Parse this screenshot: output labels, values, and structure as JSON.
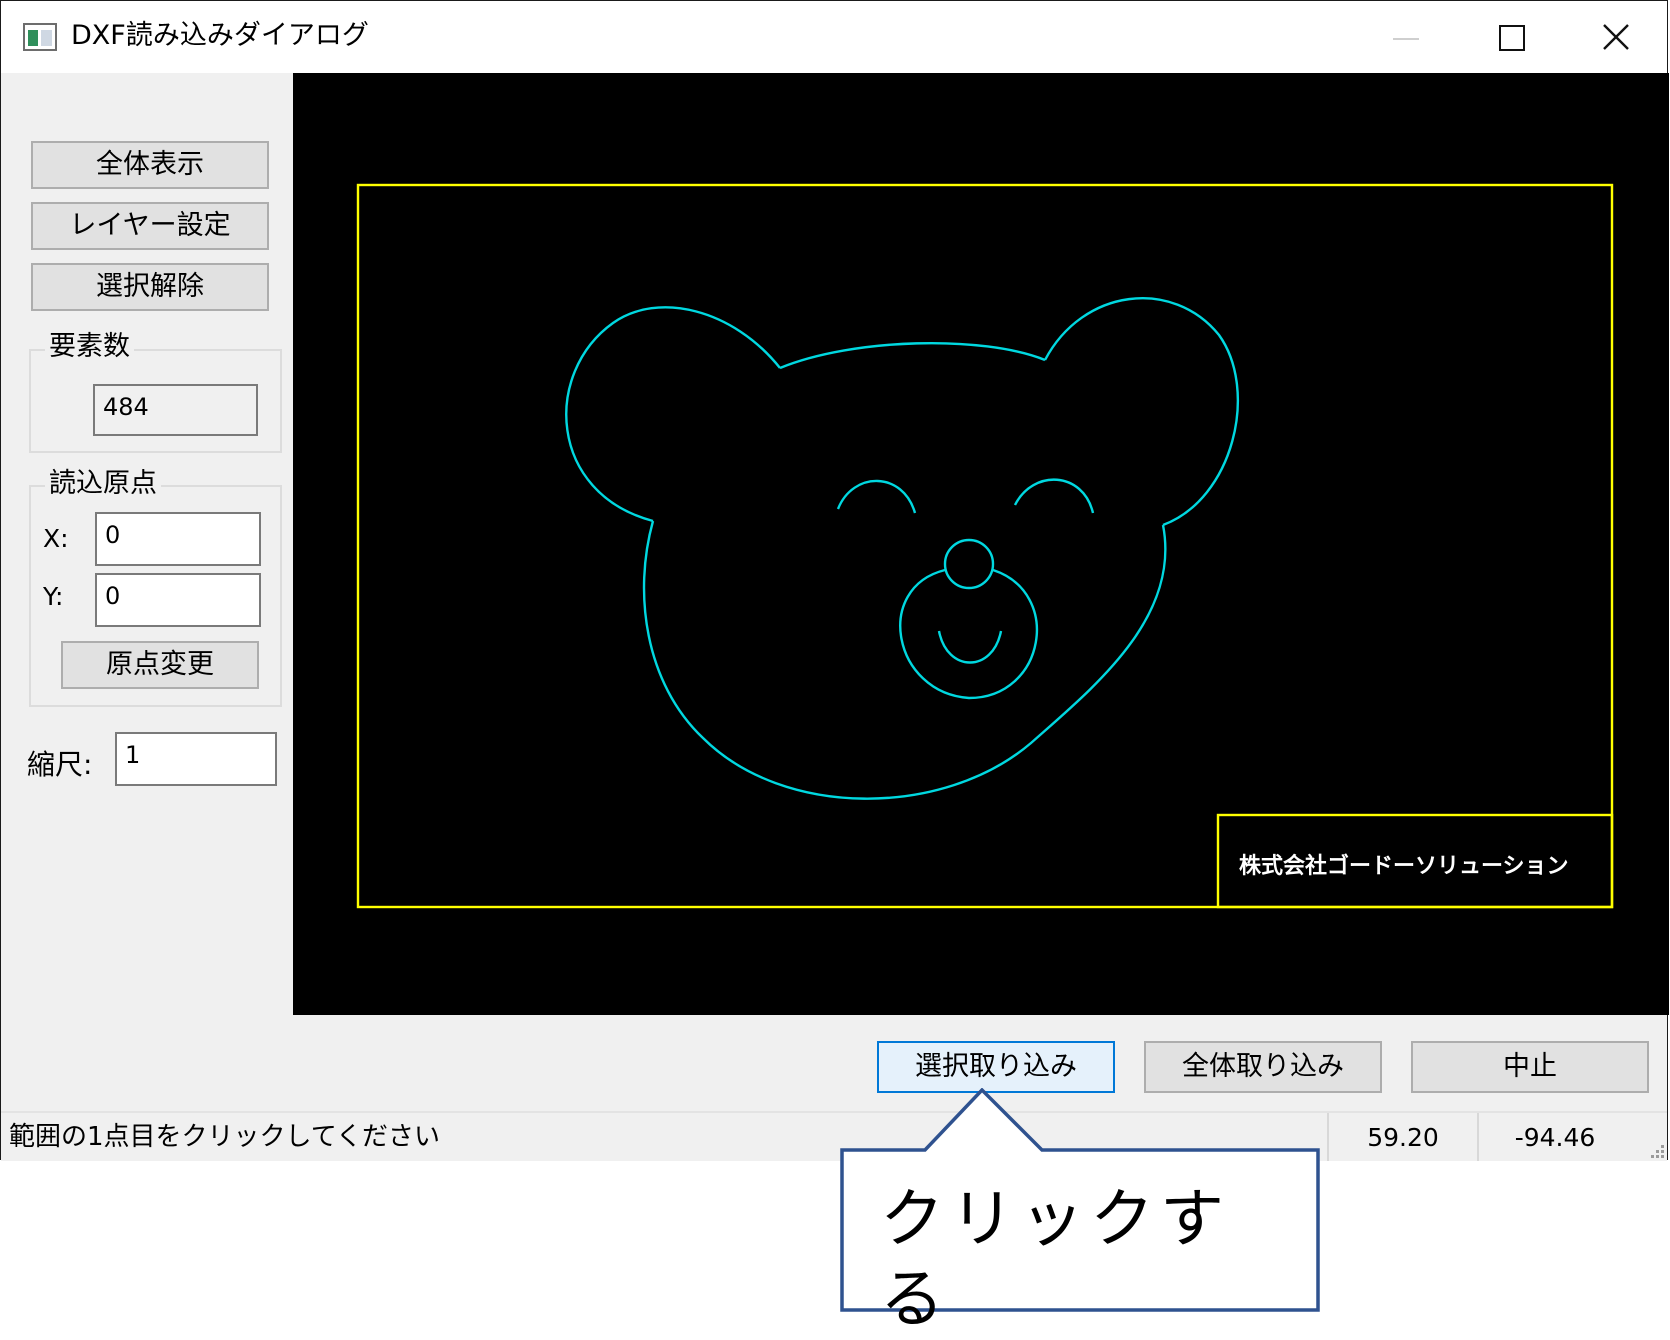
{
  "window": {
    "title": "DXF読み込みダイアログ"
  },
  "sidebar": {
    "buttons": [
      "全体表示",
      "レイヤー設定",
      "選択解除"
    ],
    "element_count": {
      "legend": "要素数",
      "value": "484"
    },
    "origin": {
      "legend": "読込原点",
      "x_label": "X:",
      "x_value": "0",
      "y_label": "Y:",
      "y_value": "0",
      "change_button": "原点変更"
    },
    "scale": {
      "label": "縮尺:",
      "value": "1"
    }
  },
  "canvas": {
    "background": "#000000",
    "frame_color": "#ffff00",
    "drawing_color": "#00d8e0",
    "title_block_text": "株式会社ゴードーソリューション"
  },
  "actions": {
    "import_selection": "選択取り込み",
    "import_all": "全体取り込み",
    "cancel": "中止"
  },
  "status": {
    "message": "範囲の1点目をクリックしてください",
    "x": "59.20",
    "y": "-94.46"
  },
  "callout": {
    "text": "クリックする"
  },
  "icons": {
    "app": "window-app-icon",
    "minimize": "minimize-icon",
    "maximize": "maximize-icon",
    "close": "close-icon",
    "grip": "resize-grip-icon"
  }
}
